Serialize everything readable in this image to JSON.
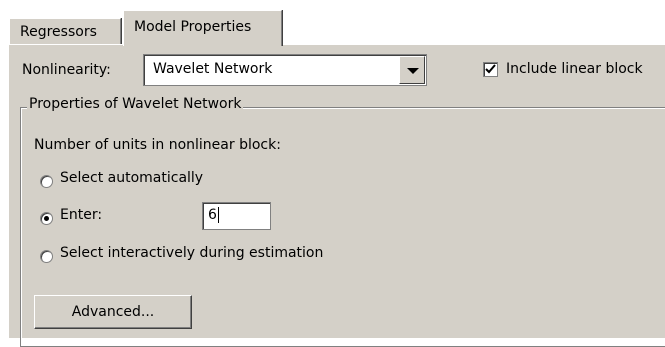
{
  "tabs": [
    {
      "label": "Regressors",
      "active": false
    },
    {
      "label": "Model Properties",
      "active": true
    }
  ],
  "nonlinearity": {
    "label": "Nonlinearity:",
    "selected": "Wavelet Network"
  },
  "include_linear": {
    "label": "Include linear block",
    "checked": true
  },
  "properties_group": {
    "title": "Properties of Wavelet Network",
    "units_label": "Number of units in nonlinear block:",
    "options": [
      {
        "label": "Select automatically",
        "selected": false
      },
      {
        "label": "Enter:",
        "selected": true
      },
      {
        "label": "Select interactively during estimation",
        "selected": false
      }
    ],
    "enter_value": "6"
  },
  "advanced_button": {
    "label": "Advanced..."
  },
  "colors": {
    "panel": "#d4d0c8",
    "background": "#ffffff"
  },
  "icons": {
    "dropdown": "chevron-down-icon",
    "checkmark": "checkmark-icon"
  }
}
